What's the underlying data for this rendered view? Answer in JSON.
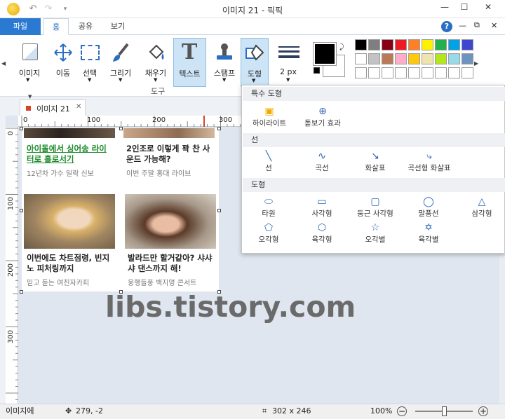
{
  "window": {
    "title": "이미지 21 - 픽픽",
    "minimize": "—",
    "maximize": "☐",
    "close": "✕"
  },
  "quick_access": {
    "undo": "↶",
    "redo": "↷",
    "more": "▾"
  },
  "menu_tabs": [
    {
      "label": "파일"
    },
    {
      "label": "홈"
    },
    {
      "label": "공유"
    },
    {
      "label": "보기"
    }
  ],
  "ribbon_right": {
    "help": "?",
    "min": "—",
    "restore": "⧉",
    "close": "✕"
  },
  "tools": [
    {
      "label": "이미지",
      "icon": "image-icon"
    },
    {
      "label": "이동",
      "icon": "move-icon"
    },
    {
      "label": "선택",
      "icon": "select-icon"
    },
    {
      "label": "그리기",
      "icon": "brush-icon"
    },
    {
      "label": "채우기",
      "icon": "fill-icon"
    },
    {
      "label": "텍스트",
      "icon": "text-icon"
    },
    {
      "label": "스탬프",
      "icon": "stamp-icon"
    },
    {
      "label": "도형",
      "icon": "shape-icon"
    },
    {
      "label": "2 px",
      "icon": "line-width-icon"
    }
  ],
  "group_label": "도구",
  "colors": {
    "primary": "#000000",
    "secondary": "#ffffff",
    "palette": [
      "#000000",
      "#7f7f7f",
      "#880015",
      "#ed1c24",
      "#ff7f27",
      "#fff200",
      "#22b14c",
      "#00a2e8",
      "#3f48cc",
      "#ffffff",
      "#c3c3c3",
      "#b97a57",
      "#ffaec9",
      "#ffc90e",
      "#efe4b0",
      "#b5e61d",
      "#99d9ea",
      "#7092be",
      "#ffffff",
      "#ffffff",
      "#ffffff",
      "#ffffff",
      "#ffffff",
      "#ffffff",
      "#ffffff",
      "#ffffff",
      "#ffffff"
    ]
  },
  "doc_tab": {
    "label": "이미지 21",
    "close": "✕"
  },
  "ruler_h": [
    "0",
    "100",
    "200",
    "300"
  ],
  "ruler_v": [
    "0",
    "100",
    "200",
    "300"
  ],
  "shapes_menu": {
    "sections": [
      {
        "header": "특수 도형",
        "items": [
          {
            "label": "하이라이트",
            "glyph": "▣"
          },
          {
            "label": "돋보기 효과",
            "glyph": "⊕"
          }
        ]
      },
      {
        "header": "선",
        "items": [
          {
            "label": "선",
            "glyph": "╲"
          },
          {
            "label": "곡선",
            "glyph": "∿"
          },
          {
            "label": "화살표",
            "glyph": "↘"
          },
          {
            "label": "곡선형 화살표",
            "glyph": "⤷"
          }
        ]
      },
      {
        "header": "도형",
        "items": [
          {
            "label": "타원",
            "glyph": "⬭"
          },
          {
            "label": "사각형",
            "glyph": "▭"
          },
          {
            "label": "둥근 사각형",
            "glyph": "▢"
          },
          {
            "label": "말풍선",
            "glyph": "◯"
          },
          {
            "label": "삼각형",
            "glyph": "△"
          },
          {
            "label": "오각형",
            "glyph": "⬠"
          },
          {
            "label": "육각형",
            "glyph": "⬡"
          },
          {
            "label": "오각별",
            "glyph": "☆"
          },
          {
            "label": "육각별",
            "glyph": "✡"
          }
        ]
      }
    ]
  },
  "cards": [
    {
      "title": "아이돌에서 싱어송 라이터로 홀로서기",
      "sub": "12년차 가수 일락 신보"
    },
    {
      "title": "2인조로 이렇게 꽉 찬 사운드 가능해?",
      "sub": "이번 주말 홍대 라이브"
    },
    {
      "title": "이번에도 차트점령, 빈지노 피처링까지",
      "sub": "믿고 듣는 여친자카피"
    },
    {
      "title": "발라드만 할거같아? 샤샤샤 댄스까지 해!",
      "sub": "웅행들풍 백지영 콘서트"
    }
  ],
  "watermark": "libs.tistory.com",
  "status": {
    "left": "이미지에",
    "cursor": "279, -2",
    "size": "302 x 246",
    "zoom": "100%",
    "zoom_minus": "−",
    "zoom_plus": "+",
    "zoom_level": 0.5
  }
}
